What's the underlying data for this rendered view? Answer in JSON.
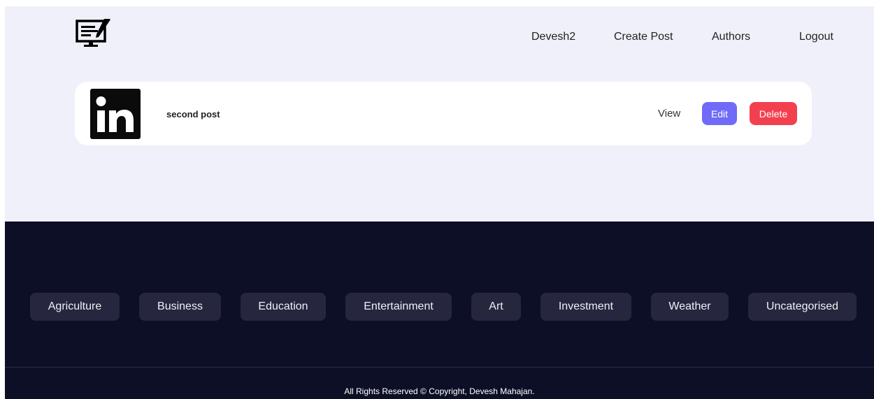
{
  "nav": {
    "user": "Devesh2",
    "create_post": "Create Post",
    "authors": "Authors",
    "logout": "Logout"
  },
  "post": {
    "title": "second post",
    "thumbnail_icon": "linkedin-icon",
    "view_label": "View",
    "edit_label": "Edit",
    "delete_label": "Delete"
  },
  "footer": {
    "categories": [
      "Agriculture",
      "Business",
      "Education",
      "Entertainment",
      "Art",
      "Investment",
      "Weather",
      "Uncategorised"
    ],
    "copyright": "All Rights Reserved © Copyright, Devesh Mahajan."
  },
  "colors": {
    "page_bg": "#f0f0fa",
    "footer_bg": "#0c0f25",
    "category_bg": "#26263f",
    "edit": "#6f6af7",
    "delete": "#f3404f"
  }
}
